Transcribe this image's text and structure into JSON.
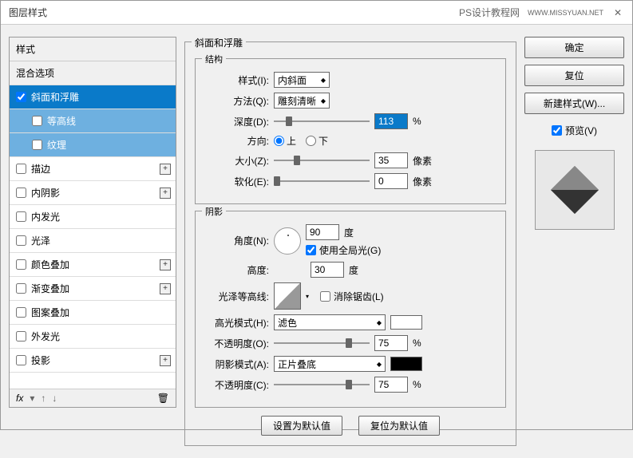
{
  "window": {
    "title": "图层样式",
    "watermark": "PS设计教程网",
    "watermark2": "WWW.MISSYUAN.NET"
  },
  "styles": {
    "header": "样式",
    "blend": "混合选项",
    "items": [
      {
        "label": "斜面和浮雕",
        "checked": true,
        "selected": true,
        "plus": false
      },
      {
        "label": "等高线",
        "checked": false,
        "sub": true,
        "subsel": true
      },
      {
        "label": "纹理",
        "checked": false,
        "sub": true,
        "subsel": true
      },
      {
        "label": "描边",
        "checked": false,
        "plus": true
      },
      {
        "label": "内阴影",
        "checked": false,
        "plus": true
      },
      {
        "label": "内发光",
        "checked": false,
        "plus": false
      },
      {
        "label": "光泽",
        "checked": false,
        "plus": false
      },
      {
        "label": "颜色叠加",
        "checked": false,
        "plus": true
      },
      {
        "label": "渐变叠加",
        "checked": false,
        "plus": true
      },
      {
        "label": "图案叠加",
        "checked": false,
        "plus": false
      },
      {
        "label": "外发光",
        "checked": false,
        "plus": false
      },
      {
        "label": "投影",
        "checked": false,
        "plus": true
      }
    ],
    "fx": "fx"
  },
  "bevel": {
    "title": "斜面和浮雕",
    "structure": {
      "title": "结构",
      "style": {
        "label": "样式(I):",
        "value": "内斜面"
      },
      "technique": {
        "label": "方法(Q):",
        "value": "雕刻清晰"
      },
      "depth": {
        "label": "深度(D):",
        "value": "113",
        "unit": "%"
      },
      "direction": {
        "label": "方向:",
        "up": "上",
        "down": "下"
      },
      "size": {
        "label": "大小(Z):",
        "value": "35",
        "unit": "像素"
      },
      "soften": {
        "label": "软化(E):",
        "value": "0",
        "unit": "像素"
      }
    },
    "shading": {
      "title": "阴影",
      "angle": {
        "label": "角度(N):",
        "value": "90",
        "unit": "度"
      },
      "global": "使用全局光(G)",
      "altitude": {
        "label": "高度:",
        "value": "30",
        "unit": "度"
      },
      "gloss": {
        "label": "光泽等高线:",
        "antialias": "消除锯齿(L)"
      },
      "highlight": {
        "label": "高光模式(H):",
        "value": "滤色"
      },
      "hopacity": {
        "label": "不透明度(O):",
        "value": "75",
        "unit": "%"
      },
      "shadow": {
        "label": "阴影模式(A):",
        "value": "正片叠底"
      },
      "sopacity": {
        "label": "不透明度(C):",
        "value": "75",
        "unit": "%"
      }
    },
    "buttons": {
      "default": "设置为默认值",
      "reset": "复位为默认值"
    }
  },
  "right": {
    "ok": "确定",
    "cancel": "复位",
    "newstyle": "新建样式(W)...",
    "preview": "预览(V)"
  }
}
